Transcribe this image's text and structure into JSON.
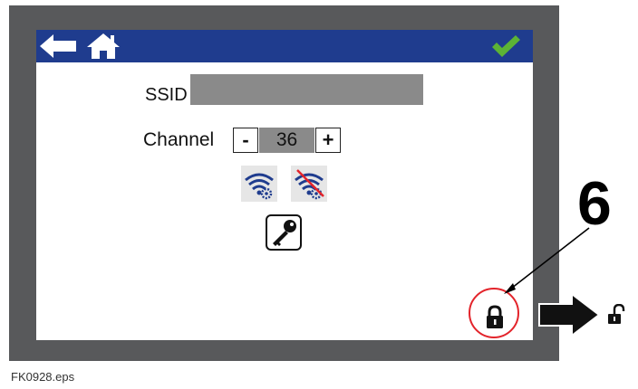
{
  "topbar": {
    "back_icon": "arrow-left-icon",
    "home_icon": "home-icon",
    "confirm_icon": "checkmark-icon",
    "bar_color": "#1f3c8e",
    "check_color": "#5cb335"
  },
  "ssid": {
    "label": "SSID",
    "value": ""
  },
  "channel": {
    "label": "Channel",
    "minus_label": "-",
    "value": "36",
    "plus_label": "+"
  },
  "wifi_buttons": [
    {
      "icon": "wifi-settings-icon"
    },
    {
      "icon": "wifi-disabled-settings-icon"
    }
  ],
  "key_button": {
    "icon": "key-icon"
  },
  "lock_button": {
    "icon": "lock-icon"
  },
  "callout": {
    "number": "6",
    "circle_color": "#e3242b",
    "result_icon": "unlock-icon"
  },
  "figure_label": "FK0928.eps"
}
